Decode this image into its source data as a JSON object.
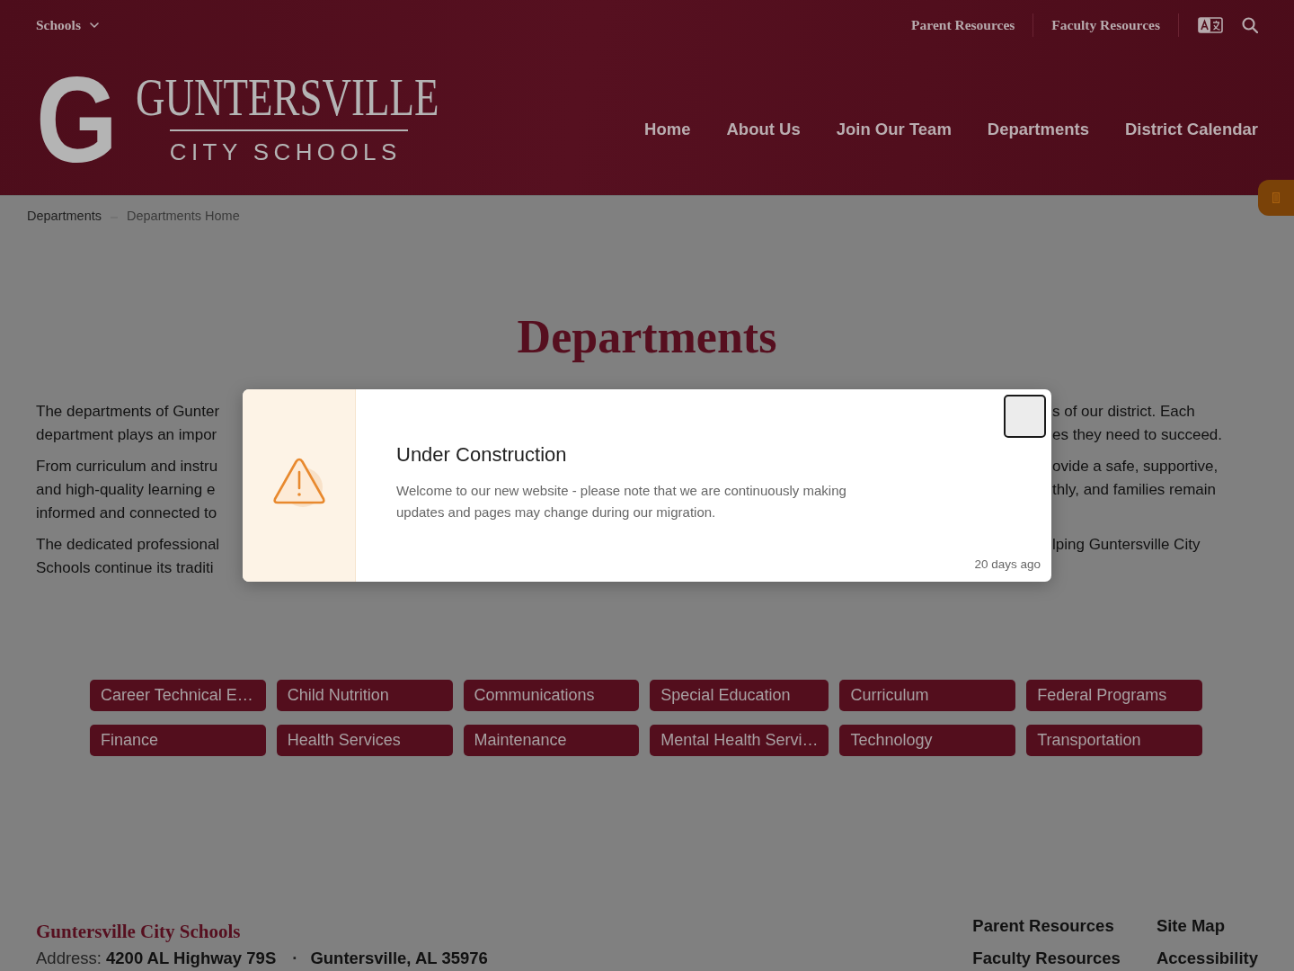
{
  "top_bar": {
    "menu_label": "Schools",
    "links": [
      "Parent Resources",
      "Faculty Resources"
    ]
  },
  "logo": {
    "letter": "G",
    "title": "GUNTERSVILLE",
    "subtitle": "CITY SCHOOLS"
  },
  "nav": [
    "Home",
    "About Us",
    "Join Our Team",
    "Departments",
    "District Calendar"
  ],
  "breadcrumb": [
    {
      "label": "Departments",
      "current": false
    },
    {
      "label": "Departments Home",
      "current": true
    }
  ],
  "page_title": "Departments",
  "intro_paragraphs": [
    {
      "lines": [
        {
          "left": "The departments of Gunter",
          "right": "s of our district. Each"
        },
        {
          "left": "department plays an impor",
          "right": "es they need to succeed."
        }
      ]
    },
    {
      "lines": [
        {
          "left": "From curriculum and instru",
          "right": "ovide a safe, supportive,"
        },
        {
          "left": "and high-quality learning e",
          "right": "thly, and families remain"
        },
        {
          "left": "informed and connected to"
        }
      ]
    },
    {
      "lines": [
        {
          "left": "The dedicated professional",
          "right": "lping Guntersville City"
        },
        {
          "left": "Schools continue its traditi"
        }
      ]
    }
  ],
  "department_buttons": [
    "Career Technical E…",
    "Child Nutrition",
    "Communications",
    "Special Education",
    "Curriculum",
    "Federal Programs",
    "Finance",
    "Health Services",
    "Maintenance",
    "Mental Health Servi…",
    "Technology",
    "Transportation"
  ],
  "modal": {
    "title": "Under Construction",
    "message": "Welcome to our new website - please note that we are continuously making updates and pages may change during our migration.",
    "time": "20 days ago"
  },
  "footer": {
    "name": "Guntersville City Schools",
    "address_label": "Address:",
    "street": "4200 AL Highway 79S",
    "separator": "·",
    "city": "Guntersville, AL 35976",
    "links": [
      "Parent Resources",
      "Site Map",
      "Faculty Resources",
      "Accessibility"
    ]
  }
}
